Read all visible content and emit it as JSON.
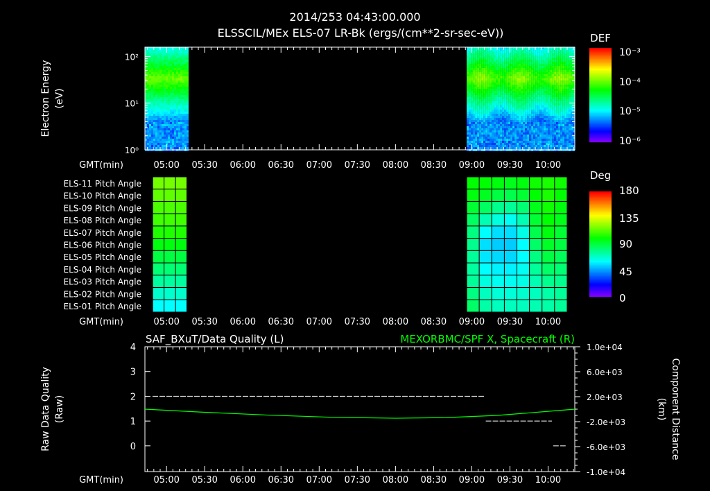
{
  "header": {
    "datetime": "2014/253 04:43:00.000",
    "title": "ELSSCIL/MEx ELS-07 LR-Bk  (ergs/(cm**2-sr-sec-eV))"
  },
  "time_axis": {
    "label": "GMT(min)",
    "ticks": [
      "05:00",
      "05:30",
      "06:00",
      "06:30",
      "07:00",
      "07:30",
      "08:00",
      "08:30",
      "09:00",
      "09:30",
      "10:00"
    ],
    "start_min": 283,
    "end_min": 621
  },
  "chart_data": [
    {
      "type": "heatmap",
      "name": "energy-spectrogram",
      "ylabel": "Electron Energy",
      "yunits": "(eV)",
      "yscale": "log",
      "ylim": [
        1,
        158
      ],
      "yticks": [
        "10⁰",
        "10¹",
        "10²"
      ],
      "colorbar": {
        "label": "DEF",
        "ticks": [
          "10⁻³",
          "10⁻⁴",
          "10⁻⁵",
          "10⁻⁶"
        ],
        "range_log": [
          -6.3,
          -3
        ]
      },
      "coverage_min": [
        [
          283,
          316
        ],
        [
          536,
          621
        ]
      ],
      "peak_energy_ev": 40,
      "peak_def_log": -4.0
    },
    {
      "type": "heatmap",
      "name": "pitch-angle",
      "rows": [
        "ELS-11 Pitch Angle",
        "ELS-10 Pitch Angle",
        "ELS-09 Pitch Angle",
        "ELS-08 Pitch Angle",
        "ELS-07 Pitch Angle",
        "ELS-06 Pitch Angle",
        "ELS-05 Pitch Angle",
        "ELS-04 Pitch Angle",
        "ELS-03 Pitch Angle",
        "ELS-02 Pitch Angle",
        "ELS-01 Pitch Angle"
      ],
      "colorbar": {
        "label": "Deg",
        "ticks": [
          "180",
          "135",
          "90",
          "45",
          "0"
        ],
        "range": [
          0,
          180
        ]
      },
      "blocks": [
        {
          "start_min": 288,
          "end_min": 316,
          "values": [
            [
              118,
              118,
              118
            ],
            [
              115,
              115,
              115
            ],
            [
              112,
              112,
              112
            ],
            [
              110,
              110,
              110
            ],
            [
              105,
              105,
              105
            ],
            [
              98,
              98,
              98
            ],
            [
              90,
              90,
              90
            ],
            [
              82,
              82,
              82
            ],
            [
              75,
              75,
              75
            ],
            [
              68,
              68,
              68
            ],
            [
              60,
              60,
              60
            ]
          ]
        },
        {
          "start_min": 536,
          "end_min": 615,
          "values": [
            [
              100,
              100,
              98,
              96,
              98,
              102,
              104,
              102
            ],
            [
              98,
              95,
              90,
              88,
              92,
              100,
              104,
              100
            ],
            [
              92,
              85,
              78,
              76,
              82,
              96,
              102,
              98
            ],
            [
              85,
              72,
              65,
              62,
              72,
              92,
              100,
              96
            ],
            [
              80,
              60,
              55,
              55,
              64,
              88,
              98,
              92
            ],
            [
              78,
              55,
              52,
              52,
              60,
              84,
              94,
              90
            ],
            [
              76,
              56,
              54,
              54,
              60,
              80,
              90,
              86
            ],
            [
              75,
              60,
              58,
              58,
              62,
              76,
              84,
              82
            ],
            [
              76,
              65,
              62,
              62,
              64,
              72,
              78,
              78
            ],
            [
              80,
              70,
              66,
              66,
              68,
              70,
              74,
              76
            ],
            [
              84,
              74,
              70,
              70,
              70,
              72,
              74,
              76
            ]
          ]
        }
      ]
    },
    {
      "type": "line",
      "name": "data-quality-and-position",
      "left_title": "SAF_BXuT/Data Quality (L)",
      "right_title": "MEXORBMC/SPF X, Spacecraft (R)",
      "ylabel_left": "Raw Data Quality",
      "yunits_left": "(Raw)",
      "ylim_left": [
        -1.04,
        4
      ],
      "yticks_left": [
        "4",
        "3",
        "2",
        "1",
        "0"
      ],
      "ylabel_right": "Component Distance",
      "yunits_right": "(km)",
      "ylim_right": [
        -10000,
        10000
      ],
      "yticks_right": [
        "1.0e+04",
        "6.0e+03",
        "2.0e+03",
        "-2.0e+03",
        "-6.0e+03",
        "-1.0e+04"
      ],
      "series": [
        {
          "name": "Data Quality",
          "color": "#ffffff",
          "segments": [
            {
              "x_min": [
                289,
                550
              ],
              "y": 2
            },
            {
              "x_min": [
                551,
                603
              ],
              "y": 1
            },
            {
              "x_min": [
                604,
                614
              ],
              "y": 0
            }
          ]
        },
        {
          "name": "SPF X",
          "color": "#00ff00",
          "x_min": [
            283,
            330,
            380,
            430,
            480,
            520,
            560,
            600,
            621
          ],
          "y_km": [
            0,
            -500,
            -950,
            -1300,
            -1450,
            -1350,
            -1000,
            -350,
            0
          ]
        }
      ]
    }
  ]
}
